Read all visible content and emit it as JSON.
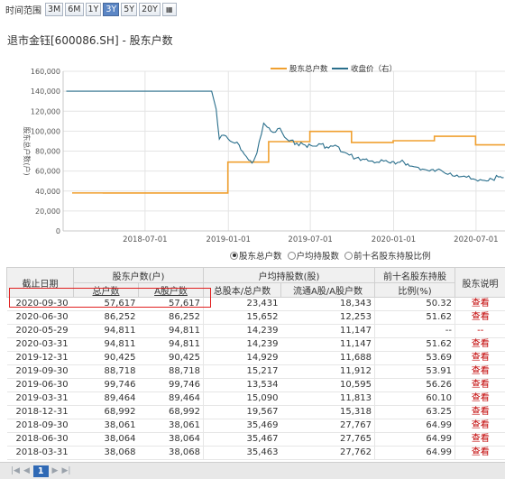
{
  "range_bar": {
    "label": "时间范围",
    "buttons": [
      "3M",
      "6M",
      "1Y",
      "3Y",
      "5Y",
      "20Y"
    ],
    "active": "3Y",
    "grid_icon": "grid-icon"
  },
  "title": "退市金钰[600086.SH] - 股东户数",
  "colors": {
    "holders_line": "#f0a030",
    "price_line": "#2a6f8c",
    "highlight": "#e02020",
    "link": "#c00000"
  },
  "chart_data": {
    "type": "line",
    "legend": [
      "股东总户数",
      "收盘价（右）"
    ],
    "legend_position": "top-right",
    "y_left_ticks": [
      "0",
      "20,000",
      "40,000",
      "60,000",
      "80,000",
      "100,000",
      "120,000",
      "140,000",
      "160,000"
    ],
    "y_left_range": [
      0,
      160000
    ],
    "y_left_label": "股东总户数(户)",
    "x_ticks": [
      "2018-07-01",
      "2019-01-01",
      "2019-07-01",
      "2020-01-01",
      "2020-07-01"
    ],
    "grid": true,
    "series": [
      {
        "name": "股东总户数",
        "kind": "step",
        "points": [
          [
            "2018-03-31",
            38068
          ],
          [
            "2018-06-30",
            38064
          ],
          [
            "2018-09-30",
            38061
          ],
          [
            "2018-12-31",
            68992
          ],
          [
            "2019-03-31",
            89464
          ],
          [
            "2019-06-30",
            99746
          ],
          [
            "2019-09-30",
            88718
          ],
          [
            "2019-12-31",
            90425
          ],
          [
            "2020-03-31",
            94811
          ],
          [
            "2020-05-29",
            94811
          ],
          [
            "2020-06-30",
            86252
          ],
          [
            "2020-09-30",
            57617
          ]
        ]
      },
      {
        "name": "收盘价（右）",
        "kind": "line",
        "points_in_left_axis_units": [
          [
            "2018-01-08",
            140000
          ],
          [
            "2018-11-25",
            140000
          ],
          [
            "2018-12-05",
            122000
          ],
          [
            "2018-12-12",
            92000
          ],
          [
            "2018-12-22",
            96000
          ],
          [
            "2019-01-05",
            90000
          ],
          [
            "2019-01-15",
            88000
          ],
          [
            "2019-01-25",
            86000
          ],
          [
            "2019-02-05",
            77000
          ],
          [
            "2019-02-15",
            71000
          ],
          [
            "2019-02-22",
            68000
          ],
          [
            "2019-03-05",
            78000
          ],
          [
            "2019-03-15",
            97000
          ],
          [
            "2019-03-20",
            108000
          ],
          [
            "2019-03-28",
            104000
          ],
          [
            "2019-04-05",
            100000
          ],
          [
            "2019-04-15",
            99000
          ],
          [
            "2019-04-25",
            103000
          ],
          [
            "2019-05-05",
            94000
          ],
          [
            "2019-05-15",
            90000
          ],
          [
            "2019-06-01",
            88000
          ],
          [
            "2019-06-20",
            86000
          ],
          [
            "2019-07-10",
            85000
          ],
          [
            "2019-07-25",
            87000
          ],
          [
            "2019-08-10",
            83000
          ],
          [
            "2019-08-25",
            86000
          ],
          [
            "2019-09-10",
            79000
          ],
          [
            "2019-09-25",
            76000
          ],
          [
            "2019-10-10",
            73000
          ],
          [
            "2019-10-25",
            72000
          ],
          [
            "2019-11-10",
            70000
          ],
          [
            "2019-11-25",
            69000
          ],
          [
            "2019-12-10",
            70000
          ],
          [
            "2019-12-25",
            68000
          ],
          [
            "2020-01-05",
            67000
          ],
          [
            "2020-01-20",
            71000
          ],
          [
            "2020-02-05",
            65000
          ],
          [
            "2020-02-20",
            64000
          ],
          [
            "2020-03-05",
            62000
          ],
          [
            "2020-03-20",
            60000
          ],
          [
            "2020-04-05",
            61000
          ],
          [
            "2020-04-20",
            59000
          ],
          [
            "2020-05-05",
            58000
          ],
          [
            "2020-05-20",
            56000
          ],
          [
            "2020-06-05",
            55000
          ],
          [
            "2020-06-20",
            52000
          ],
          [
            "2020-07-05",
            50000
          ],
          [
            "2020-07-20",
            50500
          ],
          [
            "2020-08-05",
            52000
          ],
          [
            "2020-08-20",
            54000
          ],
          [
            "2020-08-31",
            53500
          ]
        ]
      }
    ]
  },
  "radio_options": [
    {
      "label": "股东总户数",
      "selected": true
    },
    {
      "label": "户均持股数",
      "selected": false
    },
    {
      "label": "前十名股东持股比例",
      "selected": false
    }
  ],
  "table": {
    "header_groups": {
      "date": "截止日期",
      "holders": "股东户数(户)",
      "avg": "户均持股数(股)",
      "top10": "前十名股东持股",
      "top10_sub": "比例(%)",
      "desc": "股东说明"
    },
    "sub_headers": [
      "总户数",
      "A股户数",
      "总股本/总户数",
      "流通A股/A股户数"
    ],
    "link_label": "查看",
    "rows": [
      {
        "date": "2020-09-30",
        "total": "57,617",
        "a": "57,617",
        "avg_total": "23,431",
        "avg_float": "18,343",
        "top10": "50.32",
        "link": "查看"
      },
      {
        "date": "2020-06-30",
        "total": "86,252",
        "a": "86,252",
        "avg_total": "15,652",
        "avg_float": "12,253",
        "top10": "51.62",
        "link": "查看"
      },
      {
        "date": "2020-05-29",
        "total": "94,811",
        "a": "94,811",
        "avg_total": "14,239",
        "avg_float": "11,147",
        "top10": "--",
        "link": "--"
      },
      {
        "date": "2020-03-31",
        "total": "94,811",
        "a": "94,811",
        "avg_total": "14,239",
        "avg_float": "11,147",
        "top10": "51.62",
        "link": "查看"
      },
      {
        "date": "2019-12-31",
        "total": "90,425",
        "a": "90,425",
        "avg_total": "14,929",
        "avg_float": "11,688",
        "top10": "53.69",
        "link": "查看"
      },
      {
        "date": "2019-09-30",
        "total": "88,718",
        "a": "88,718",
        "avg_total": "15,217",
        "avg_float": "11,912",
        "top10": "53.91",
        "link": "查看"
      },
      {
        "date": "2019-06-30",
        "total": "99,746",
        "a": "99,746",
        "avg_total": "13,534",
        "avg_float": "10,595",
        "top10": "56.26",
        "link": "查看"
      },
      {
        "date": "2019-03-31",
        "total": "89,464",
        "a": "89,464",
        "avg_total": "15,090",
        "avg_float": "11,813",
        "top10": "60.10",
        "link": "查看"
      },
      {
        "date": "2018-12-31",
        "total": "68,992",
        "a": "68,992",
        "avg_total": "19,567",
        "avg_float": "15,318",
        "top10": "63.25",
        "link": "查看"
      },
      {
        "date": "2018-09-30",
        "total": "38,061",
        "a": "38,061",
        "avg_total": "35,469",
        "avg_float": "27,767",
        "top10": "64.99",
        "link": "查看"
      },
      {
        "date": "2018-06-30",
        "total": "38,064",
        "a": "38,064",
        "avg_total": "35,467",
        "avg_float": "27,765",
        "top10": "64.99",
        "link": "查看"
      },
      {
        "date": "2018-03-31",
        "total": "38,068",
        "a": "38,068",
        "avg_total": "35,463",
        "avg_float": "27,762",
        "top10": "64.99",
        "link": "查看"
      }
    ]
  },
  "pager": {
    "current_page": "1"
  }
}
